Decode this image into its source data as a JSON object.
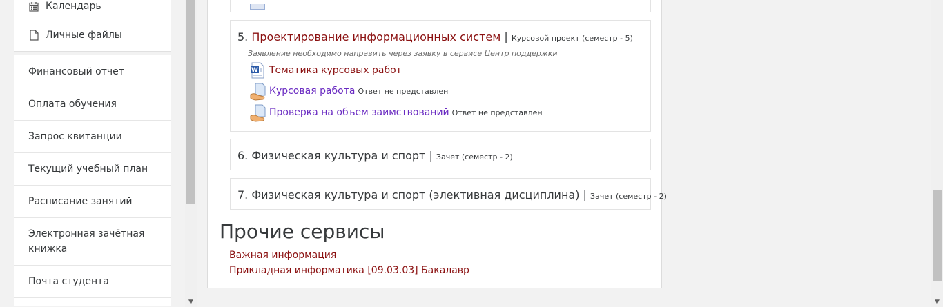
{
  "sidebar": {
    "top_items": [
      {
        "label": "Календарь",
        "icon": "calendar-icon"
      },
      {
        "label": "Личные файлы",
        "icon": "file-icon"
      }
    ],
    "items": [
      {
        "label": "Финансовый отчет"
      },
      {
        "label": "Оплата обучения"
      },
      {
        "label": "Запрос квитанции"
      },
      {
        "label": "Текущий учебный план"
      },
      {
        "label": "Расписание занятий"
      },
      {
        "label": "Электронная зачётная книжка"
      },
      {
        "label": "Почта студента"
      }
    ]
  },
  "courses": [
    {
      "number": "5.",
      "name": "Проектирование информационных систем",
      "separator": "|",
      "meta": "Курсовой проект (семестр - 5)",
      "note": "Заявление необходимо направить через заявку в сервисе",
      "note_link": "Центр поддержки",
      "activities": [
        {
          "label": "Тематика курсовых работ",
          "icon": "word-document-icon",
          "status": ""
        },
        {
          "label": "Курсовая работа",
          "icon": "assignment-icon",
          "status": "Ответ не представлен"
        },
        {
          "label": "Проверка на объем заимствований",
          "icon": "assignment-icon",
          "status": "Ответ не представлен"
        }
      ]
    },
    {
      "number": "6.",
      "name": "Физическая культура и спорт",
      "separator": "|",
      "meta": "Зачет (семестр - 2)"
    },
    {
      "number": "7.",
      "name": "Физическая культура и спорт (элективная дисциплина)",
      "separator": "|",
      "meta": "Зачет (семестр - 2)"
    }
  ],
  "other_services": {
    "title": "Прочие сервисы",
    "links": [
      {
        "label": "Важная информация"
      },
      {
        "label": "Прикладная информатика [09.03.03] Бакалавр"
      }
    ]
  },
  "colors": {
    "link": "#8b1111",
    "visited_link": "#6a2bc2",
    "text": "#373a3c"
  }
}
